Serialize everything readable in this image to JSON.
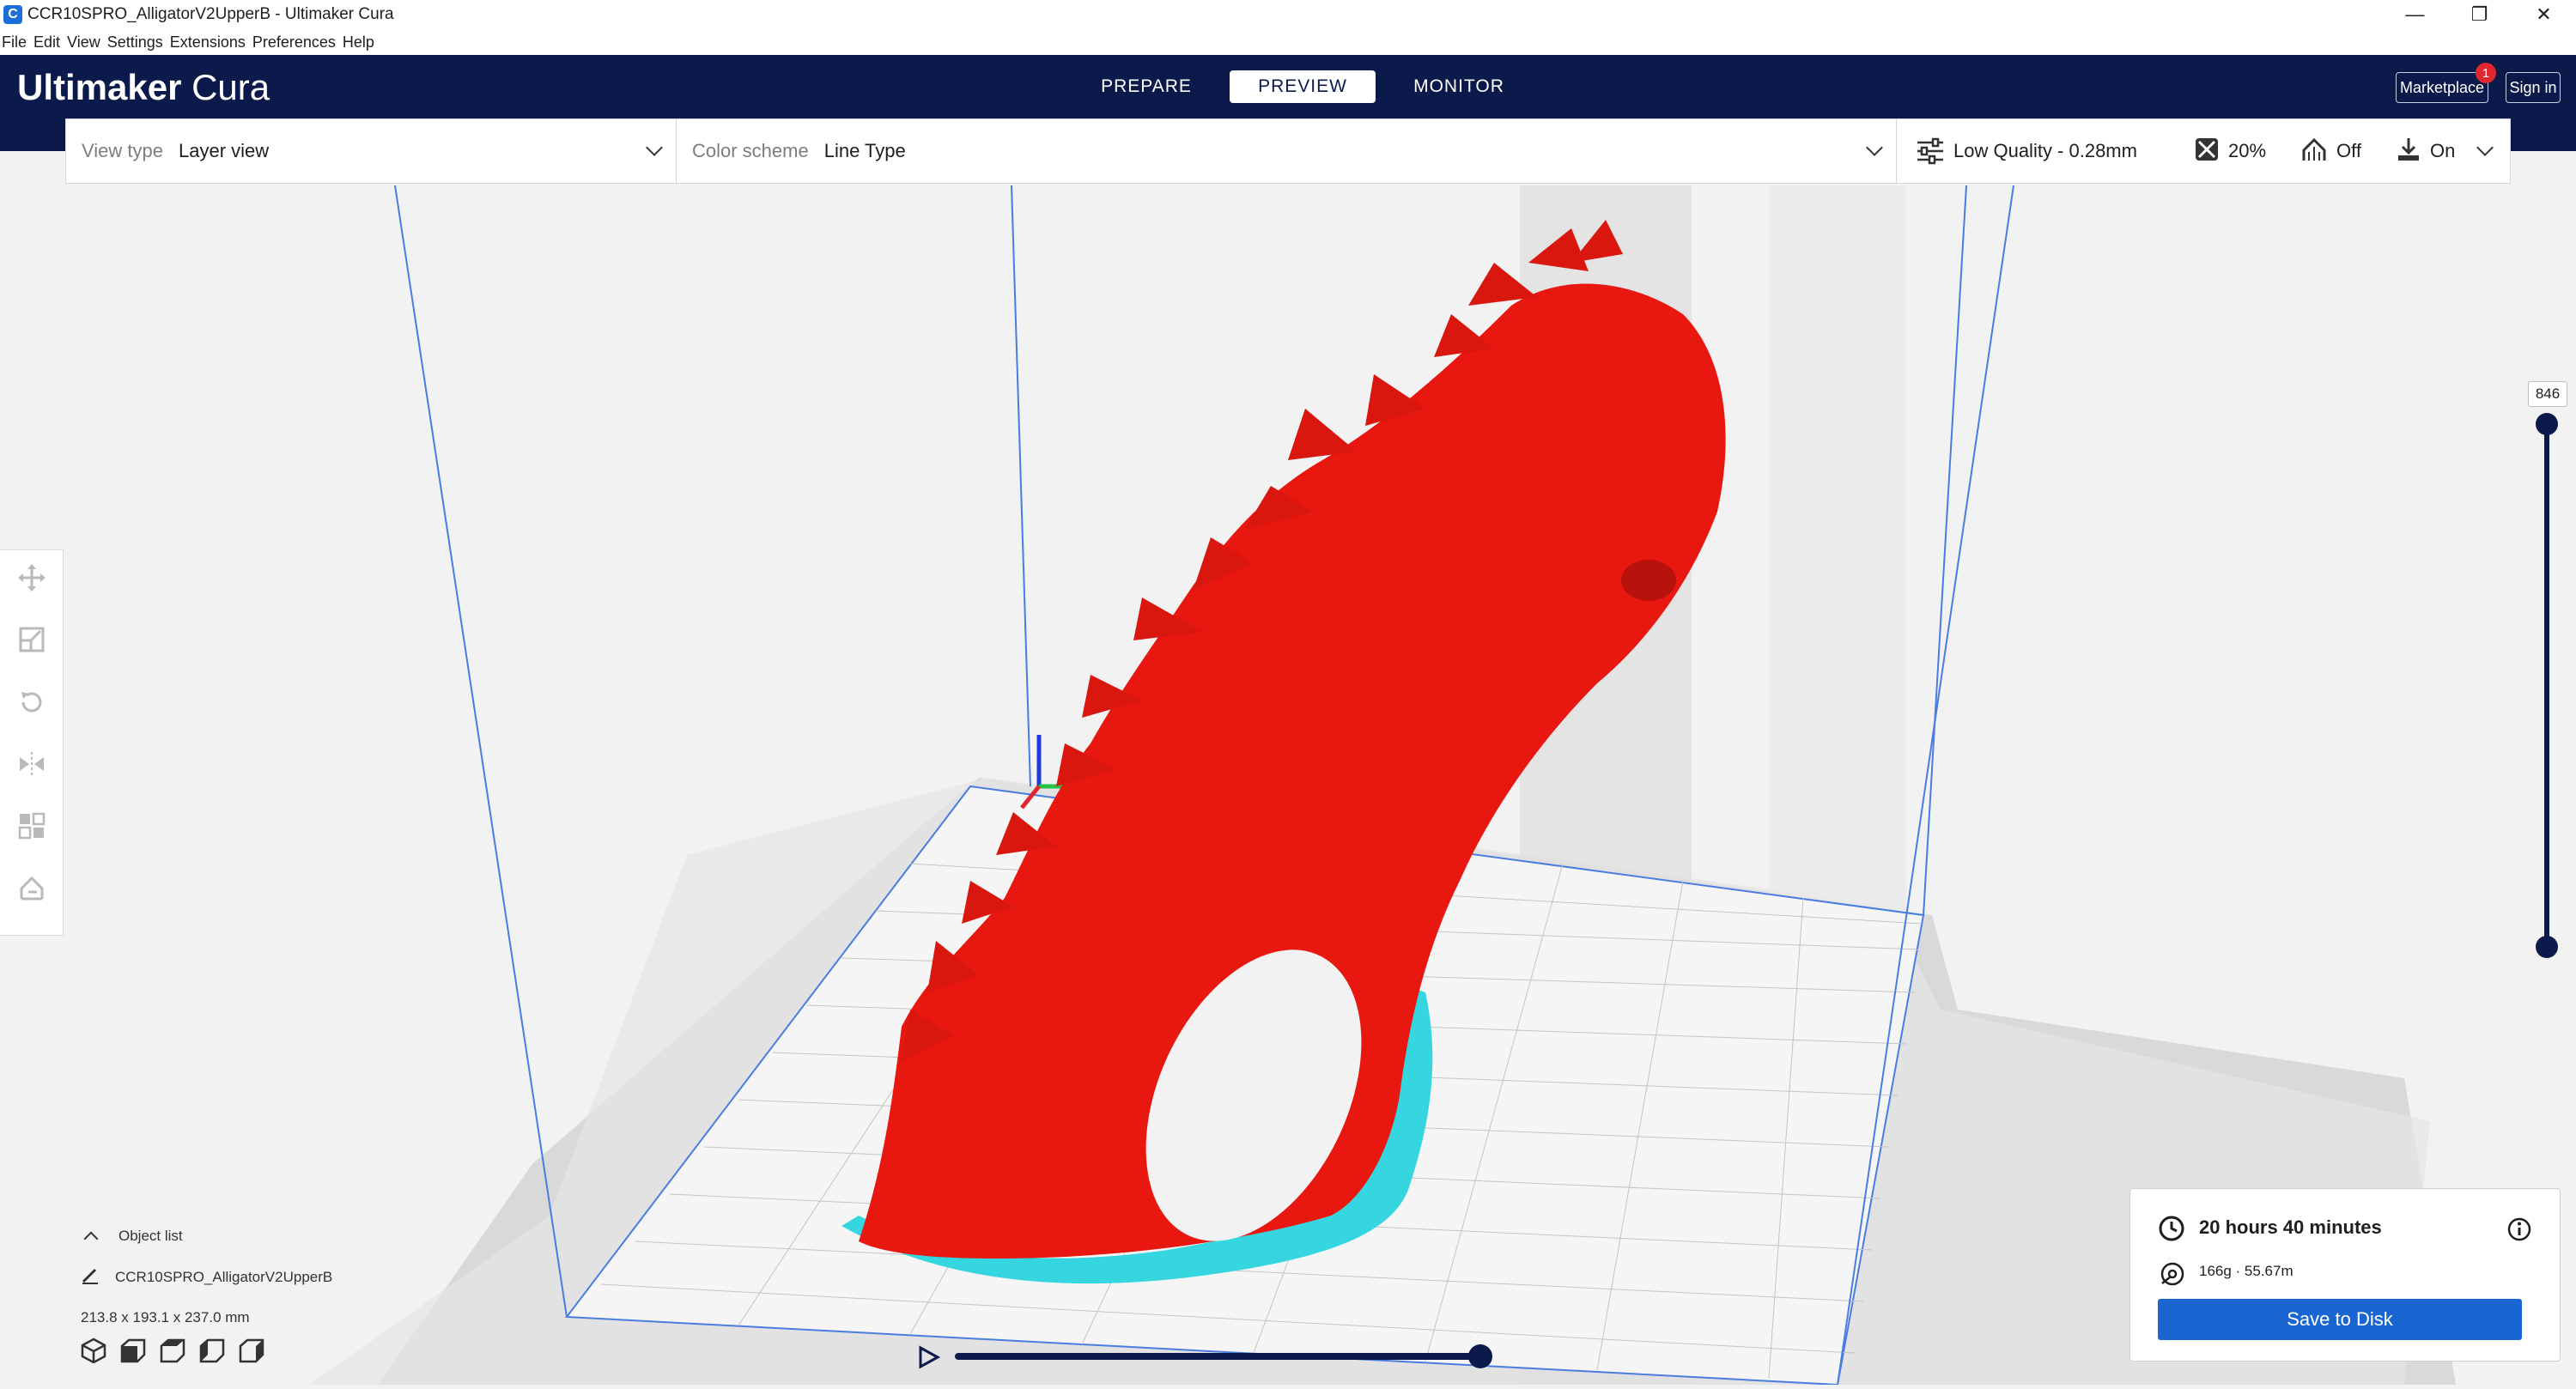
{
  "window": {
    "title": "CCR10SPRO_AlligatorV2UpperB - Ultimaker Cura",
    "app_icon": "C",
    "controls": [
      "—",
      "❐",
      "✕"
    ]
  },
  "menu": [
    "File",
    "Edit",
    "View",
    "Settings",
    "Extensions",
    "Preferences",
    "Help"
  ],
  "header": {
    "logo_bold": "Ultimaker",
    "logo_light": "Cura",
    "tabs": [
      {
        "label": "PREPARE",
        "active": false
      },
      {
        "label": "PREVIEW",
        "active": true
      },
      {
        "label": "MONITOR",
        "active": false
      }
    ],
    "marketplace_label": "Marketplace",
    "marketplace_badge": "1",
    "signin_label": "Sign in"
  },
  "toolbar": {
    "view_type_label": "View type",
    "view_type_value": "Layer view",
    "color_scheme_label": "Color scheme",
    "color_scheme_value": "Line Type",
    "quality": "Low Quality - 0.28mm",
    "infill": "20%",
    "support": "Off",
    "adhesion": "On"
  },
  "layer_slider": {
    "top_value": "846"
  },
  "object_list": {
    "title": "Object list",
    "object_name": "CCR10SPRO_AlligatorV2UpperB",
    "dimensions": "213.8 x 193.1 x 237.0 mm"
  },
  "print_info": {
    "time": "20 hours 40 minutes",
    "material": "166g · 55.67m",
    "save_label": "Save to Disk"
  },
  "colors": {
    "header_bg": "#0b1a4a",
    "accent": "#1966d2",
    "model_wall": "#e8170f",
    "skirt": "#35d6e0",
    "badge": "#e0262f"
  }
}
